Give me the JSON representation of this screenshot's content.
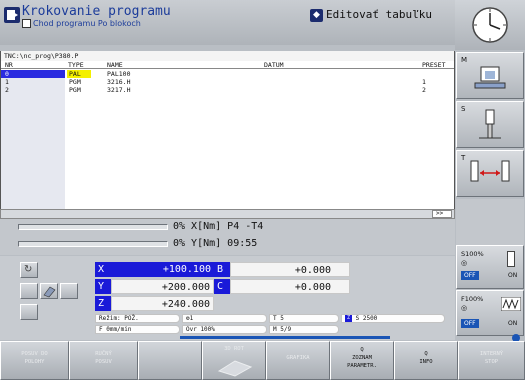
{
  "header": {
    "title": "Krokovanie programu",
    "subtitle": "Chod programu Po blokoch",
    "edit_mode": "Editovať tabuľku"
  },
  "path": "TNC:\\nc_prog\\P380.P",
  "table": {
    "columns": [
      "NR",
      "TYPE",
      "NAME",
      "DATUM",
      "PRESET"
    ],
    "rows": [
      {
        "nr": "0",
        "type": "PAL",
        "name": "PAL100",
        "datum": "",
        "preset": ""
      },
      {
        "nr": "1",
        "type": "PGM",
        "name": "3216.H",
        "datum": "",
        "preset": "1"
      },
      {
        "nr": "2",
        "type": "PGM",
        "name": "3217.H",
        "datum": "",
        "preset": "2"
      }
    ]
  },
  "scroll_right": ">>",
  "status": {
    "line1": "0% X[Nm] P4  -T4",
    "line2": "0% Y[Nm] 09:55"
  },
  "axes": [
    {
      "label": "X",
      "value": "+100.100"
    },
    {
      "label": "Y",
      "value": "+200.000"
    },
    {
      "label": "Z",
      "value": "+240.000"
    }
  ],
  "axes_right": [
    {
      "label": "B",
      "value": "+0.000"
    },
    {
      "label": "C",
      "value": "+0.000"
    }
  ],
  "state_fields": {
    "mode": "Režim: POŽ.",
    "feed": "F 0mm/min",
    "spindle_icon": "1",
    "override": "Ovr 100%",
    "tool": "T 5",
    "m": "M 5/9",
    "speed": "S 2500"
  },
  "side": {
    "m_label": "M",
    "s_label": "S",
    "t_label": "T",
    "s100": "S100%",
    "f100": "F100%",
    "off": "OFF",
    "on": "ON"
  },
  "softkeys": [
    {
      "line1": "POSUV DO",
      "line2": "POLOHY"
    },
    {
      "line1": "RUČNÝ",
      "line2": "POSUV"
    },
    {
      "line1": "",
      "line2": ""
    },
    {
      "line1": "3D ROT",
      "line2": ""
    },
    {
      "line1": "GRAFIKA",
      "line2": ""
    },
    {
      "line1": "Q",
      "line2": "ZOZNAM PARAMETR."
    },
    {
      "line1": "Q",
      "line2": "INFO"
    },
    {
      "line1": "INTERNÝ",
      "line2": "STOP"
    }
  ],
  "colors": {
    "accent_blue": "#1a1ad8",
    "title_blue": "#1c3c9a",
    "highlight_yellow": "#f4f000",
    "nr_highlight": "#2a2ae0",
    "off_blue": "#1a55b5"
  }
}
